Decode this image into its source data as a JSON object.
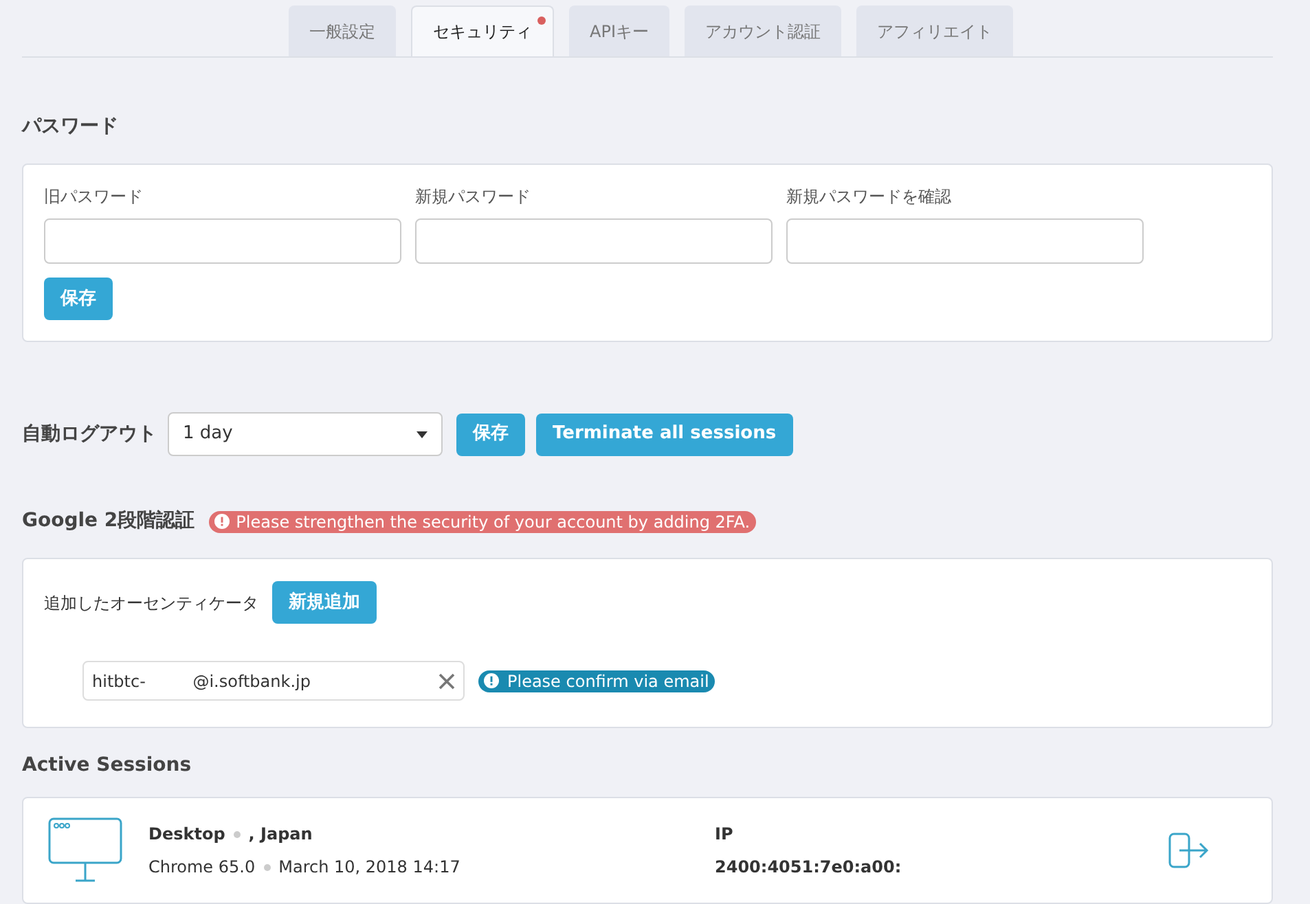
{
  "tabs": [
    {
      "label": "一般設定",
      "selected": false,
      "notification": false
    },
    {
      "label": "セキュリティ",
      "selected": true,
      "notification": true
    },
    {
      "label": "APIキー",
      "selected": false,
      "notification": false
    },
    {
      "label": "アカウント認証",
      "selected": false,
      "notification": false
    },
    {
      "label": "アフィリエイト",
      "selected": false,
      "notification": false
    }
  ],
  "password": {
    "title": "パスワード",
    "fields": [
      {
        "label": "旧パスワード"
      },
      {
        "label": "新規パスワード"
      },
      {
        "label": "新規パスワードを確認"
      }
    ],
    "save": "保存"
  },
  "auto_logout": {
    "label": "自動ログアウト",
    "value": "1 day",
    "save": "保存",
    "terminate": "Terminate all sessions"
  },
  "two_factor": {
    "title": "Google 2段階認証",
    "warning": "Please strengthen the security of your account by adding 2FA.",
    "authenticators_label": "追加したオーセンティケータ",
    "add": "新規追加",
    "authenticators": [
      {
        "value": "hitbtc-         @i.softbank.jp",
        "status": "Please confirm via email"
      }
    ]
  },
  "active_sessions": {
    "title": "Active Sessions",
    "sessions": [
      {
        "device": "Desktop",
        "location": ", Japan",
        "browser": "Chrome 65.0",
        "date": "March 10, 2018 14:17",
        "ip_label": "IP",
        "ip": "2400:4051:7e0:a00:"
      }
    ]
  }
}
